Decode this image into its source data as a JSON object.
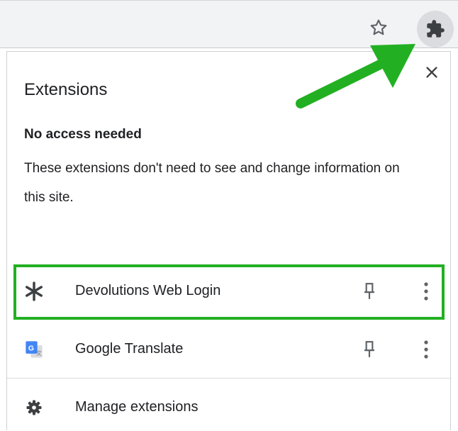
{
  "toolbar": {
    "bookmark_icon": "star-outline-icon",
    "extensions_icon": "puzzle-piece-icon"
  },
  "panel": {
    "title": "Extensions",
    "close_icon": "close-icon",
    "section": {
      "heading": "No access needed",
      "description": "These extensions don't need to see and change information on this site."
    },
    "extensions": [
      {
        "name": "Devolutions Web Login",
        "icon": "devolutions-asterisk-icon",
        "pin_icon": "pin-icon",
        "menu_icon": "more-vert-icon",
        "highlighted": true
      },
      {
        "name": "Google Translate",
        "icon": "google-translate-icon",
        "pin_icon": "pin-icon",
        "menu_icon": "more-vert-icon",
        "highlighted": false
      }
    ],
    "manage": {
      "label": "Manage extensions",
      "icon": "gear-icon"
    }
  },
  "annotation": {
    "arrow_color": "#22b022",
    "highlight_color": "#22b022"
  }
}
